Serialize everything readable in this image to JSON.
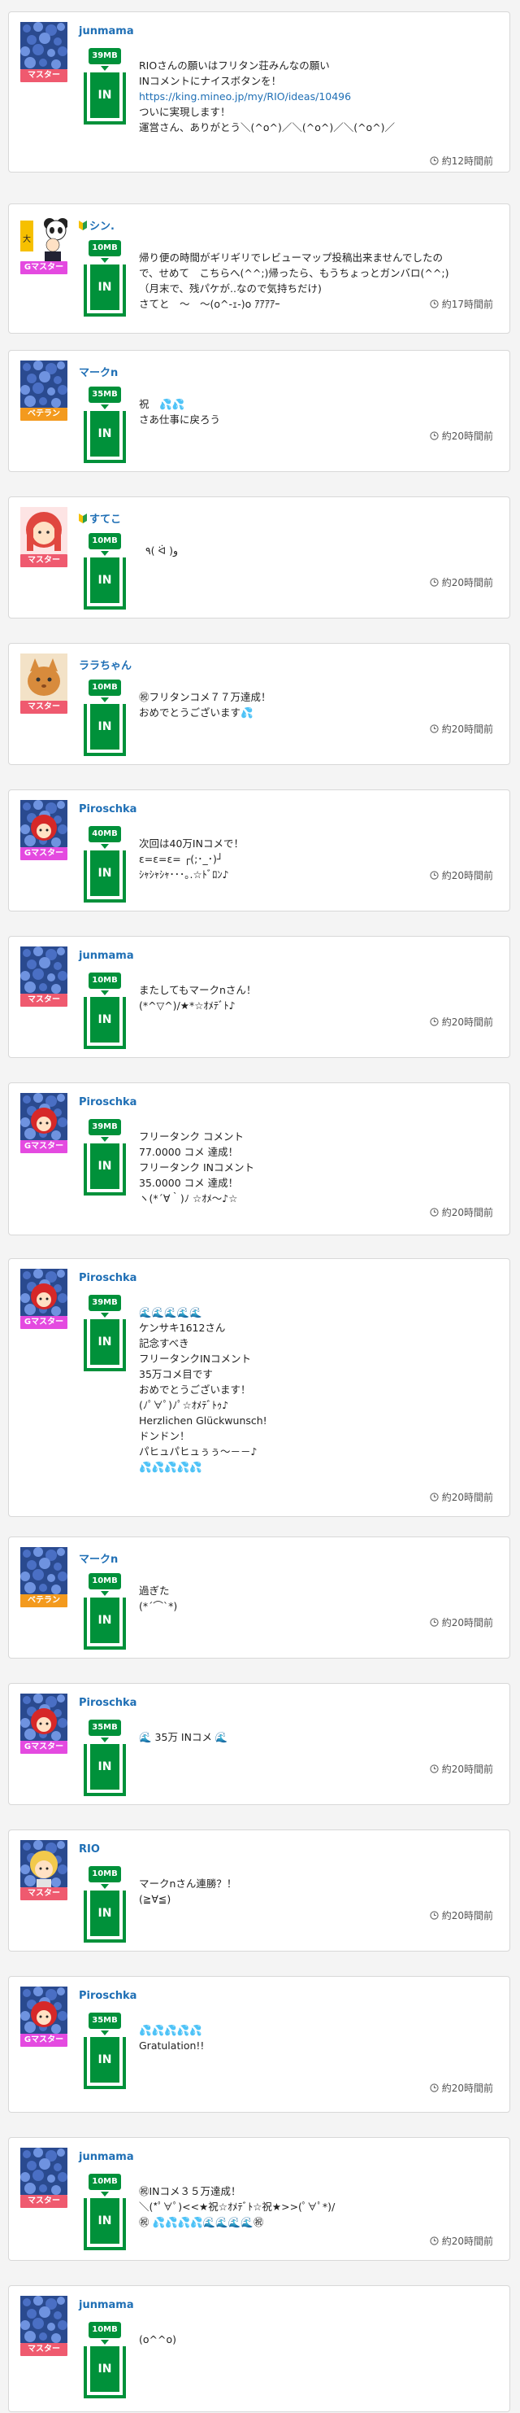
{
  "colors": {
    "user_link": "#1f6fb5",
    "in_green": "#00913a",
    "rank_master": "#ef5a6f",
    "rank_gmaster": "#e44ae0",
    "rank_veteran": "#f39a1e"
  },
  "comments": [
    {
      "user": "junmama",
      "rank": "マスター",
      "rank_type": "master",
      "mb": "39MB",
      "avatar": "hydrangea",
      "beginner": false,
      "lines": [
        "RIOさんの願いはフリタン荘みんなの願い",
        "INコメントにナイスボタンを！",
        "https://king.mineo.jp/my/RIO/ideas/10496",
        "ついに実現します！",
        "運営さん、ありがとう＼(^o^)／＼(^o^)／＼(^o^)／"
      ],
      "url_line": 2,
      "time": "約12時間前"
    },
    {
      "user": "シン.",
      "rank": "Gマスター",
      "rank_type": "gmaster",
      "mb": "10MB",
      "avatar": "panda",
      "beginner": true,
      "lines": [
        "帰り便の時間がギリギリでレビューマップ投稿出来ませんでしたの",
        "で、せめて　こちらへ(^^;)帰ったら、もうちょっとガンバロ(^^;)",
        "（月末で、残パケが..なので気持ちだけ)",
        "さてと　～　～(o^-ｪ-)o ｱｱｱｱｰ"
      ],
      "url_line": -1,
      "time": "約17時間前"
    },
    {
      "user": "マークn",
      "rank": "ベテラン",
      "rank_type": "veteran",
      "mb": "35MB",
      "avatar": "hydrangea",
      "beginner": false,
      "lines": [
        "祝　💦💦",
        "さあ仕事に戻ろう"
      ],
      "url_line": -1,
      "time": "約20時間前"
    },
    {
      "user": "すてこ",
      "rank": "マスター",
      "rank_type": "master",
      "mb": "10MB",
      "avatar": "redhair",
      "beginner": true,
      "lines": [
        "  ٩( ᐛ )و"
      ],
      "url_line": -1,
      "time": "約20時間前"
    },
    {
      "user": "ララちゃん",
      "rank": "マスター",
      "rank_type": "master",
      "mb": "10MB",
      "avatar": "cat",
      "beginner": false,
      "lines": [
        "㊗フリタンコメ７７万達成！",
        "おめでとうございます💦"
      ],
      "url_line": -1,
      "time": "約20時間前"
    },
    {
      "user": "Piroschka",
      "rank": "Gマスター",
      "rank_type": "gmaster",
      "mb": "40MB",
      "avatar": "redhood",
      "beginner": false,
      "lines": [
        "次回は40万INコメで！",
        "ε=ε=ε= ┌(;･_･)┘",
        "ｼｬｼｬｼｬ･･･｡.☆ﾄﾞﾛﾝ♪"
      ],
      "url_line": -1,
      "time": "約20時間前"
    },
    {
      "user": "junmama",
      "rank": "マスター",
      "rank_type": "master",
      "mb": "10MB",
      "avatar": "hydrangea",
      "beginner": false,
      "lines": [
        "またしてもマークnさん！",
        "(*^▽^)/★*☆ｵﾒﾃﾞﾄ♪"
      ],
      "url_line": -1,
      "time": "約20時間前"
    },
    {
      "user": "Piroschka",
      "rank": "Gマスター",
      "rank_type": "gmaster",
      "mb": "39MB",
      "avatar": "redhood",
      "beginner": false,
      "lines": [
        "フリータンク コメント",
        "77.0000 コメ 達成！",
        "フリータンク INコメント",
        "35.0000 コメ 達成！",
        "ヽ(*´∀｀)ﾉ ☆ｵﾒ～♪☆"
      ],
      "url_line": -1,
      "time": "約20時間前"
    },
    {
      "user": "Piroschka",
      "rank": "Gマスター",
      "rank_type": "gmaster",
      "mb": "39MB",
      "avatar": "redhood",
      "beginner": false,
      "lines": [
        "🌊🌊🌊🌊🌊",
        "ケンサキ1612さん",
        "記念すべき",
        "フリータンクINコメント",
        "35万コメ目です",
        "おめでとうございます！",
        "(ﾉﾟ∀ﾟ)ﾉﾟ☆ｵﾒﾃﾞﾄｩ♪",
        "Herzlichen Glückwunsch!",
        "ドンドン！",
        "パヒュパヒュぅぅ～－－♪",
        "💦💦💦💦💦"
      ],
      "url_line": -1,
      "time": "約20時間前"
    },
    {
      "user": "マークn",
      "rank": "ベテラン",
      "rank_type": "veteran",
      "mb": "10MB",
      "avatar": "hydrangea",
      "beginner": false,
      "lines": [
        "過ぎた",
        "(*´⌒`*)"
      ],
      "url_line": -1,
      "time": "約20時間前"
    },
    {
      "user": "Piroschka",
      "rank": "Gマスター",
      "rank_type": "gmaster",
      "mb": "35MB",
      "avatar": "redhood",
      "beginner": false,
      "lines": [
        "🌊 35万 INコメ 🌊"
      ],
      "url_line": -1,
      "time": "約20時間前"
    },
    {
      "user": "RIO",
      "rank": "マスター",
      "rank_type": "master",
      "mb": "10MB",
      "avatar": "blonde",
      "beginner": false,
      "lines": [
        "マークnさん連勝？！",
        "(≧∀≦)"
      ],
      "url_line": -1,
      "time": "約20時間前"
    },
    {
      "user": "Piroschka",
      "rank": "Gマスター",
      "rank_type": "gmaster",
      "mb": "35MB",
      "avatar": "redhood",
      "beginner": false,
      "lines": [
        "💦💦💦💦💦",
        "Gratulation!!"
      ],
      "url_line": -1,
      "time": "約20時間前"
    },
    {
      "user": "junmama",
      "rank": "マスター",
      "rank_type": "master",
      "mb": "10MB",
      "avatar": "hydrangea",
      "beginner": false,
      "lines": [
        "㊗INコメ３５万達成！",
        "＼(*ﾟ∀ﾟ)<<★祝☆ｵﾒﾃﾞﾄ☆祝★>>(ﾟ∀ﾟ*)/",
        "㊗ 💦💦💦💦🌊🌊🌊🌊㊗"
      ],
      "url_line": -1,
      "time": "約20時間前"
    },
    {
      "user": "junmama",
      "rank": "マスター",
      "rank_type": "master",
      "mb": "10MB",
      "avatar": "hydrangea",
      "beginner": false,
      "lines": [
        "(o^^o)"
      ],
      "url_line": -1,
      "time": ""
    }
  ]
}
